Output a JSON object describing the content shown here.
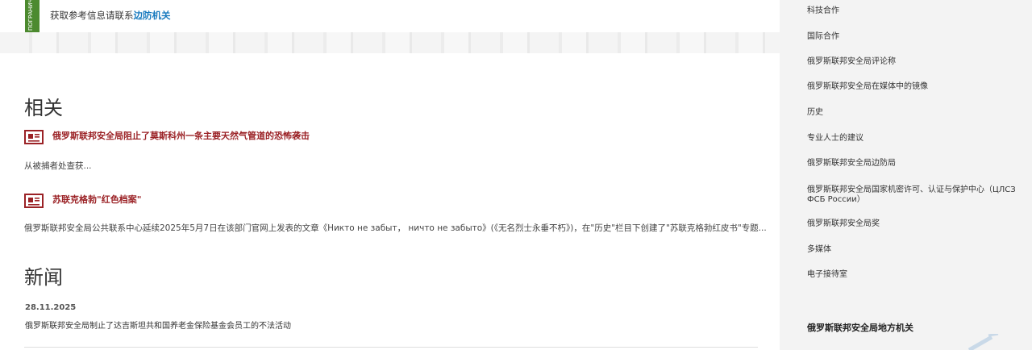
{
  "banner": {
    "badge_text": "ПОГРАНИЧ",
    "notice_prefix": "获取参考信息请联系",
    "notice_link": "边防机关"
  },
  "related": {
    "heading": "相关",
    "items": [
      {
        "title": "俄罗斯联邦安全局阻止了莫斯科州一条主要天然气管道的恐怖袭击",
        "excerpt": "从被捕者处查获..."
      },
      {
        "title": "苏联克格勃\"红色档案\"",
        "excerpt": "俄罗斯联邦安全局公共联系中心延续2025年5月7日在该部门官网上发表的文章《Никто не забыт， ничто не забыто》(《无名烈士永垂不朽》)，在\"历史\"栏目下创建了\"苏联克格勃红皮书\"专题..."
      }
    ]
  },
  "news": {
    "heading": "新闻",
    "items": [
      {
        "date": "28.11.2025",
        "title": "俄罗斯联邦安全局制止了达吉斯坦共和国养老金保险基金会员工的不法活动"
      }
    ]
  },
  "sidebar": {
    "items": [
      "科技合作",
      "国际合作",
      "俄罗斯联邦安全局评论称",
      "俄罗斯联邦安全局在媒体中的镜像",
      "历史",
      "专业人士的建议",
      "俄罗斯联邦安全局边防局",
      "俄罗斯联邦安全局国家机密许可、认证与保护中心（ЦЛСЗ ФСБ России）",
      "俄罗斯联邦安全局奖",
      "多媒体",
      "电子接待室"
    ],
    "heading": "俄罗斯联邦安全局地方机关"
  },
  "colors": {
    "accent_red": "#9b2226",
    "link_blue": "#1a7bbf",
    "badge_green": "#4c8a2f",
    "sidebar_bg": "#f3f3f3"
  },
  "icons": {
    "related_item_icon": "newspaper-icon"
  }
}
